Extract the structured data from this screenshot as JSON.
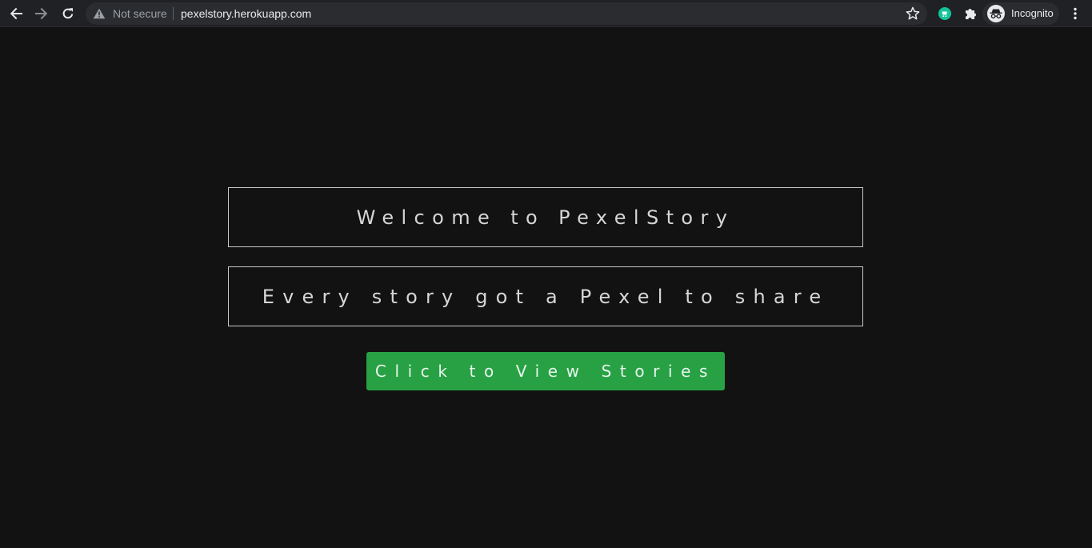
{
  "browser": {
    "security_label": "Not secure",
    "url": "pexelstory.herokuapp.com",
    "profile_label": "Incognito",
    "icons": {
      "back": "arrow-left-icon",
      "forward": "arrow-right-icon",
      "reload": "reload-icon",
      "warning": "warning-triangle-icon",
      "bookmark": "star-icon",
      "extension_1": "grammarly-icon",
      "extensions": "puzzle-icon",
      "incognito": "incognito-icon",
      "menu": "kebab-menu-icon"
    }
  },
  "page": {
    "heading": "Welcome to PexelStory",
    "tagline": "Every story got a Pexel to share",
    "cta_label": "Click to View Stories"
  },
  "colors": {
    "background": "#121212",
    "cta_background": "#28a145",
    "banner_border": "#c8c8c8",
    "text": "#d6d6d6"
  }
}
